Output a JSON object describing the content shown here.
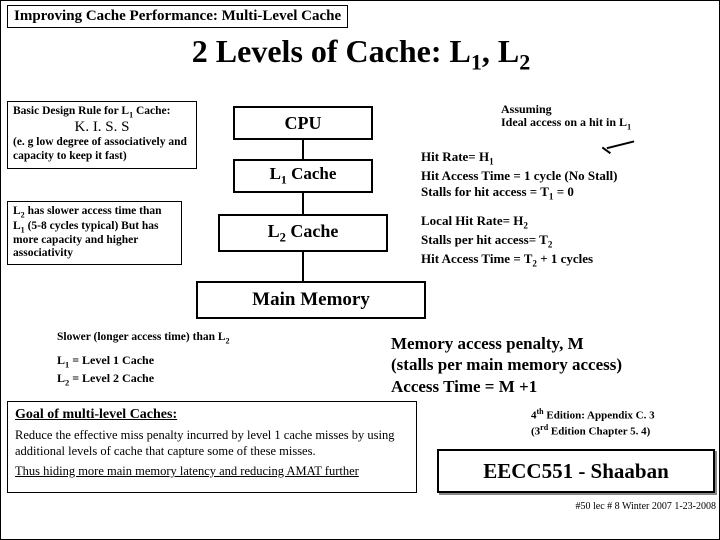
{
  "topic": "Improving Cache Performance:  Multi-Level Cache",
  "title_prefix": "2 Levels of Cache:  L",
  "title_sub1": "1",
  "title_mid": ", L",
  "title_sub2": "2",
  "rule": {
    "heading_pre": "Basic Design Rule for L",
    "heading_sub": "1",
    "heading_post": " Cache:",
    "kiss": "K. I. S. S",
    "note": "(e. g low degree of associatively and capacity to keep it fast)"
  },
  "l2box": {
    "l1_pre": "L",
    "l1_sub": "2",
    "l1_post": " has slower access time than L",
    "l2_sub": "1",
    "l2_post": " (5-8 cycles typical) But has more capacity and higher associativity"
  },
  "boxes": {
    "cpu": "CPU",
    "l1_pre": "L",
    "l1_sub": "1",
    "l1_post": " Cache",
    "l2_pre": "L",
    "l2_sub": "2",
    "l2_post": " Cache",
    "mm": "Main Memory"
  },
  "assuming": {
    "t": "Assuming",
    "line_pre": "Ideal access on a hit in L",
    "line_sub": "1"
  },
  "l1stats": {
    "a_pre": "Hit Rate= H",
    "a_sub": "1",
    "b": "Hit Access Time = 1 cycle (No Stall)",
    "c_pre": "Stalls for hit access = T",
    "c_sub": "1",
    "c_post": " = 0"
  },
  "l2stats": {
    "a_pre": "Local Hit Rate= H",
    "a_sub": "2",
    "b_pre": "Stalls per hit access= T",
    "b_sub": "2",
    "c_pre": "Hit Access Time = T",
    "c_sub": "2",
    "c_post": " + 1 cycles"
  },
  "slower_pre": "Slower (longer access time) than L",
  "slower_sub": "2",
  "legend": {
    "a_pre": "L",
    "a_sub": "1",
    "a_post": " =  Level 1 Cache",
    "b_pre": "L",
    "b_sub": "2",
    "b_post": " =  Level 2 Cache"
  },
  "penalty": {
    "a": "Memory access penalty, M",
    "b": "(stalls per main memory access)",
    "c": "Access Time = M +1"
  },
  "goal": {
    "head": "Goal of multi-level Caches:",
    "body": "Reduce the effective miss penalty incurred by level 1 cache misses by using additional levels of cache that capture some of these misses.",
    "thus": "Thus hiding more main memory latency and reducing AMAT further"
  },
  "edition": {
    "a": "4th Edition: Appendix C. 3",
    "b": "(3rd Edition Chapter 5. 4)"
  },
  "course": "EECC551 - Shaaban",
  "slidenum": "#50  lec # 8   Winter 2007  1-23-2008"
}
